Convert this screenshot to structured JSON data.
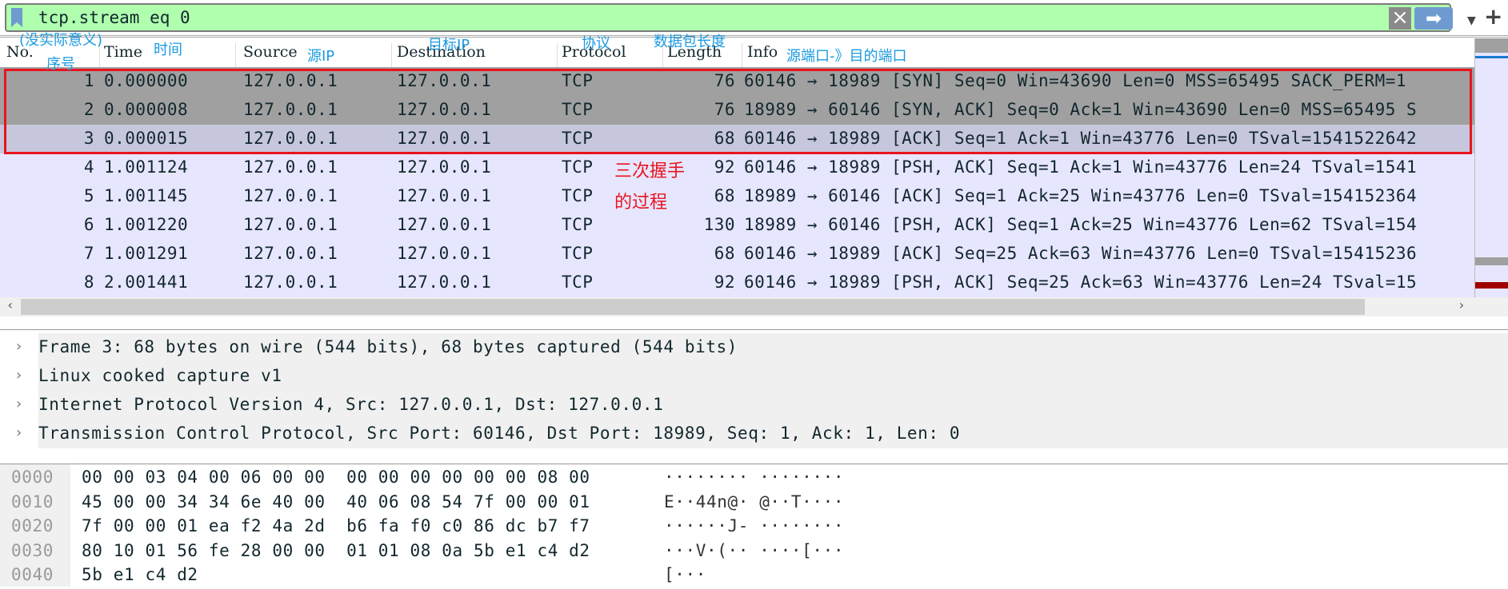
{
  "filter": {
    "value": "tcp.stream eq 0",
    "clear_icon": "close-icon",
    "apply_icon": "arrow-right-icon"
  },
  "columns": [
    "No.",
    "Time",
    "Source",
    "Destination",
    "Protocol",
    "Length",
    "Info"
  ],
  "annotations": {
    "no_1": "(没实际意义)",
    "no_2": "序号",
    "time": "时间",
    "source": "源IP",
    "destination": "目标IP",
    "protocol": "协议",
    "length": "数据包长度",
    "info": "源端口-》目的端口",
    "handshake_1": "三次握手",
    "handshake_2": "的过程"
  },
  "packets": [
    {
      "no": "1",
      "time": "0.000000",
      "src": "127.0.0.1",
      "dst": "127.0.0.1",
      "proto": "TCP",
      "len": "76",
      "info": "60146 → 18989 [SYN] Seq=0 Win=43690 Len=0 MSS=65495 SACK_PERM=1"
    },
    {
      "no": "2",
      "time": "0.000008",
      "src": "127.0.0.1",
      "dst": "127.0.0.1",
      "proto": "TCP",
      "len": "76",
      "info": "18989 → 60146 [SYN, ACK] Seq=0 Ack=1 Win=43690 Len=0 MSS=65495 S"
    },
    {
      "no": "3",
      "time": "0.000015",
      "src": "127.0.0.1",
      "dst": "127.0.0.1",
      "proto": "TCP",
      "len": "68",
      "info": "60146 → 18989 [ACK] Seq=1 Ack=1 Win=43776 Len=0 TSval=1541522642"
    },
    {
      "no": "4",
      "time": "1.001124",
      "src": "127.0.0.1",
      "dst": "127.0.0.1",
      "proto": "TCP",
      "len": "92",
      "info": "60146 → 18989 [PSH, ACK] Seq=1 Ack=1 Win=43776 Len=24 TSval=1541"
    },
    {
      "no": "5",
      "time": "1.001145",
      "src": "127.0.0.1",
      "dst": "127.0.0.1",
      "proto": "TCP",
      "len": "68",
      "info": "18989 → 60146 [ACK] Seq=1 Ack=25 Win=43776 Len=0 TSval=154152364"
    },
    {
      "no": "6",
      "time": "1.001220",
      "src": "127.0.0.1",
      "dst": "127.0.0.1",
      "proto": "TCP",
      "len": "130",
      "info": "18989 → 60146 [PSH, ACK] Seq=1 Ack=25 Win=43776 Len=62 TSval=154"
    },
    {
      "no": "7",
      "time": "1.001291",
      "src": "127.0.0.1",
      "dst": "127.0.0.1",
      "proto": "TCP",
      "len": "68",
      "info": "60146 → 18989 [ACK] Seq=25 Ack=63 Win=43776 Len=0 TSval=15415236"
    },
    {
      "no": "8",
      "time": "2.001441",
      "src": "127.0.0.1",
      "dst": "127.0.0.1",
      "proto": "TCP",
      "len": "92",
      "info": "60146 → 18989 [PSH, ACK] Seq=25 Ack=63 Win=43776 Len=24 TSval=15"
    }
  ],
  "row_colors": {
    "selected_related": "#a0a0a0",
    "selected": "#c6c6dc",
    "tcp": "#e7e6ff",
    "highlight_box": "#e8141e",
    "filter_valid": "#afffaf"
  },
  "details": [
    "Frame 3: 68 bytes on wire (544 bits), 68 bytes captured (544 bits)",
    "Linux cooked capture v1",
    "Internet Protocol Version 4, Src: 127.0.0.1, Dst: 127.0.0.1",
    "Transmission Control Protocol, Src Port: 60146, Dst Port: 18989, Seq: 1, Ack: 1, Len: 0"
  ],
  "bytes": [
    {
      "off": "0000",
      "hex": "00 00 03 04 00 06 00 00  00 00 00 00 00 00 08 00",
      "ascii": "········ ········"
    },
    {
      "off": "0010",
      "hex": "45 00 00 34 34 6e 40 00  40 06 08 54 7f 00 00 01",
      "ascii": "E··44n@· @··T····"
    },
    {
      "off": "0020",
      "hex": "7f 00 00 01 ea f2 4a 2d  b6 fa f0 c0 86 dc b7 f7",
      "ascii": "······J- ········"
    },
    {
      "off": "0030",
      "hex": "80 10 01 56 fe 28 00 00  01 01 08 0a 5b e1 c4 d2",
      "ascii": "···V·(·· ····[···"
    },
    {
      "off": "0040",
      "hex": "5b e1 c4 d2",
      "ascii": "[···"
    }
  ]
}
